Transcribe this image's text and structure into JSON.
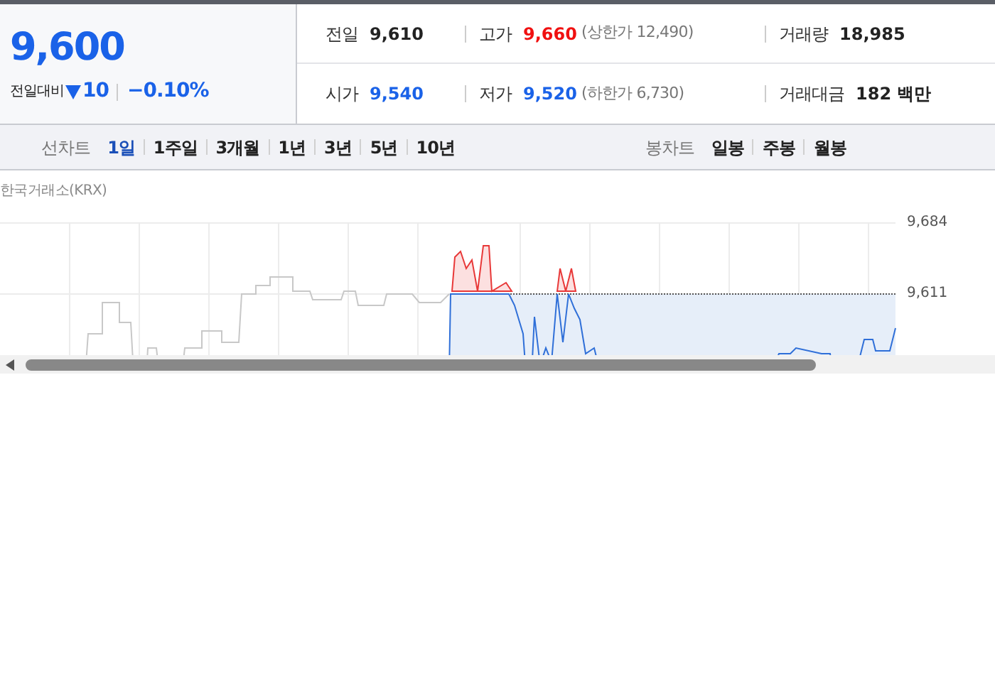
{
  "quote": {
    "price": "9,600",
    "change_label": "전일대비",
    "falling": true,
    "change": "10",
    "change_rate": "−0.10%"
  },
  "stats": [
    {
      "label": "전일",
      "value": "9,610",
      "color": "#222222"
    },
    {
      "label": "고가",
      "value": "9,660",
      "color": "#f01010",
      "limit": "(상한가 12,490)"
    },
    {
      "label": "거래량",
      "value": "18,985",
      "color": "#222222"
    },
    {
      "label": "시가",
      "value": "9,540",
      "color": "#1a62e8"
    },
    {
      "label": "저가",
      "value": "9,520",
      "color": "#1a62e8",
      "limit": "(하한가 6,730)"
    },
    {
      "label": "거래대금",
      "value": "182 백만",
      "color": "#222222"
    }
  ],
  "line_chart_tabs": {
    "title": "선차트",
    "items": [
      {
        "label": "1일",
        "selected": true
      },
      {
        "label": "1주일",
        "selected": false
      },
      {
        "label": "3개월",
        "selected": false
      },
      {
        "label": "1년",
        "selected": false
      },
      {
        "label": "3년",
        "selected": false
      },
      {
        "label": "5년",
        "selected": false
      },
      {
        "label": "10년",
        "selected": false
      }
    ]
  },
  "candle_chart_tabs": {
    "title": "봉차트",
    "items": [
      {
        "label": "일봉",
        "selected": false
      },
      {
        "label": "주봉",
        "selected": false
      },
      {
        "label": "월봉",
        "selected": false
      }
    ]
  },
  "chart": {
    "source": "한국거래소(KRX)",
    "y_labels": [
      "9,684",
      "9,611"
    ]
  }
}
